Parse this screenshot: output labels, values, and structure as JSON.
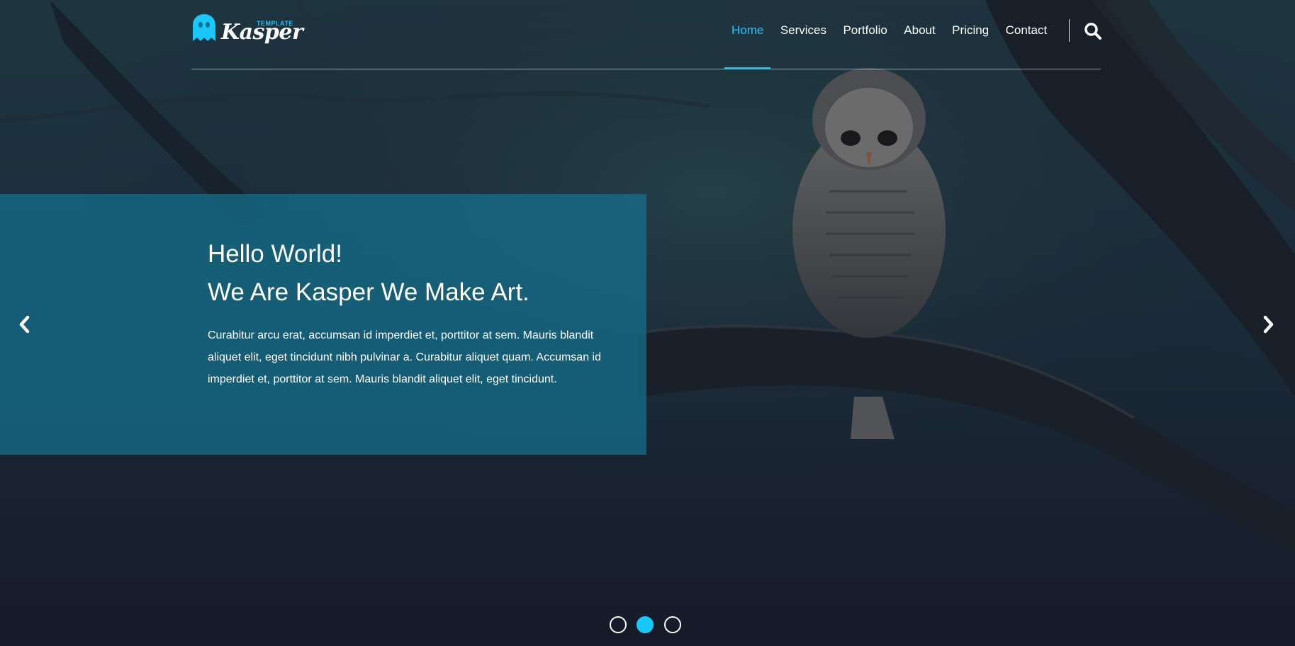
{
  "brand": {
    "name": "Kasper",
    "tag": "TEMPLATE",
    "accent_color": "#19c8fa"
  },
  "nav": {
    "items": [
      {
        "label": "Home",
        "active": true
      },
      {
        "label": "Services",
        "active": false
      },
      {
        "label": "Portfolio",
        "active": false
      },
      {
        "label": "About",
        "active": false
      },
      {
        "label": "Pricing",
        "active": false
      },
      {
        "label": "Contact",
        "active": false
      }
    ],
    "search_icon": "search-icon"
  },
  "hero": {
    "heading_line1": "Hello World!",
    "heading_line2": "We Are Kasper We Make Art.",
    "body": "Curabitur arcu erat, accumsan id imperdiet et, porttitor at sem. Mauris blandit aliquet elit, eget tincidunt nibh pulvinar a. Curabitur aliquet quam. Accumsan id imperdiet et, porttitor at sem. Mauris blandit aliquet elit, eget tincidunt.",
    "caption_color": "#137694",
    "prev_icon": "chevron-left-icon",
    "next_icon": "chevron-right-icon"
  },
  "slider": {
    "slide_count": 3,
    "active_slide": 2
  }
}
